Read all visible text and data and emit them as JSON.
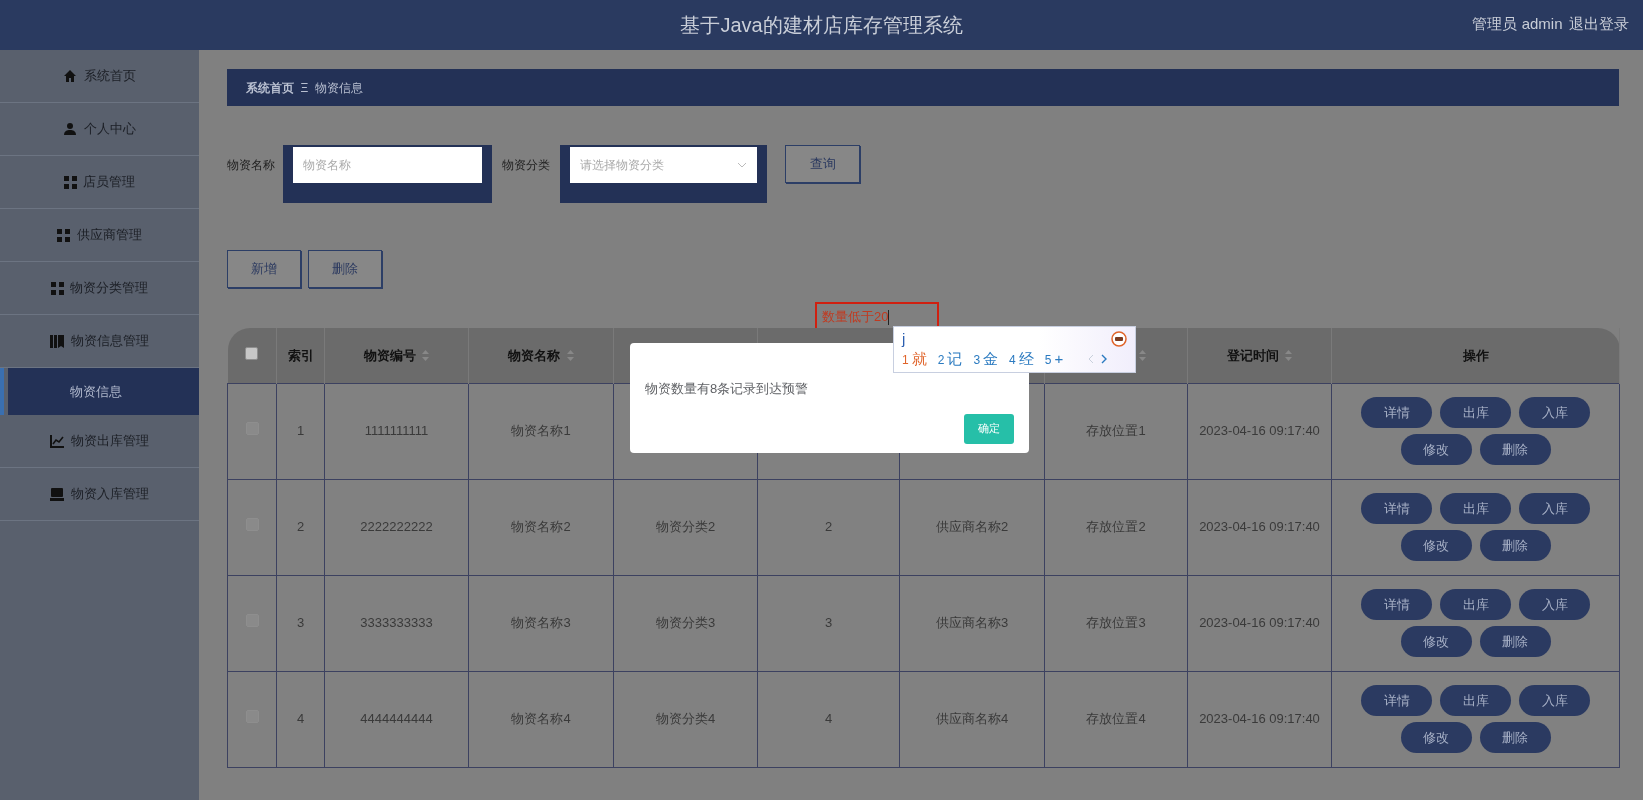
{
  "header": {
    "title": "基于Java的建材店库存管理系统",
    "user": "管理员 admin",
    "logout": "退出登录"
  },
  "sidebar": {
    "items": [
      {
        "label": "系统首页",
        "selected": false
      },
      {
        "label": "个人中心",
        "selected": false
      },
      {
        "label": "店员管理",
        "selected": false
      },
      {
        "label": "供应商管理",
        "selected": false
      },
      {
        "label": "物资分类管理",
        "selected": false
      },
      {
        "label": "物资信息管理",
        "selected": false,
        "children": [
          {
            "label": "物资信息",
            "selected": true
          }
        ]
      },
      {
        "label": "物资出库管理",
        "selected": false
      },
      {
        "label": "物资入库管理",
        "selected": false
      }
    ]
  },
  "breadcrumb": [
    "系统首页",
    "物资信息"
  ],
  "breadcrumb_separator": "Ξ",
  "search": {
    "fields": [
      {
        "label": "物资名称",
        "placeholder": "物资名称",
        "kind": "input"
      },
      {
        "label": "物资分类",
        "placeholder": "请选择物资分类",
        "kind": "select"
      }
    ],
    "button": "查询"
  },
  "toolbar": [
    "新增",
    "删除"
  ],
  "warning_input": {
    "value": "数量低于20"
  },
  "table": {
    "header_checked": false,
    "columns": [
      {
        "label": "索引",
        "sortable": false
      },
      {
        "label": "物资编号",
        "sortable": true
      },
      {
        "label": "物资名称",
        "sortable": true
      },
      {},
      {},
      {},
      {
        "sortable": true
      },
      {
        "label": "登记时间",
        "sortable": true
      },
      {
        "label": "操作",
        "sortable": false
      }
    ],
    "rows": [
      {
        "checked": false,
        "index": "1",
        "code": "1111111111",
        "name": "物资名称1",
        "location": "存放位置1",
        "time": "2023-04-16 09:17:40",
        "actions": [
          "详情",
          "出库",
          "入库",
          "修改",
          "删除"
        ]
      },
      {
        "checked": false,
        "index": "2",
        "code": "2222222222",
        "name": "物资名称2",
        "category": "物资分类2",
        "quantity": "2",
        "supplier": "供应商名称2",
        "location": "存放位置2",
        "time": "2023-04-16 09:17:40",
        "actions": [
          "详情",
          "出库",
          "入库",
          "修改",
          "删除"
        ]
      },
      {
        "checked": false,
        "index": "3",
        "code": "3333333333",
        "name": "物资名称3",
        "category": "物资分类3",
        "quantity": "3",
        "supplier": "供应商名称3",
        "location": "存放位置3",
        "time": "2023-04-16 09:17:40",
        "actions": [
          "详情",
          "出库",
          "入库",
          "修改",
          "删除"
        ]
      },
      {
        "checked": false,
        "index": "4",
        "code": "4444444444",
        "name": "物资名称4",
        "category": "物资分类4",
        "quantity": "4",
        "supplier": "供应商名称4",
        "location": "存放位置4",
        "time": "2023-04-16 09:17:40",
        "actions": [
          "详情",
          "出库",
          "入库",
          "修改",
          "删除"
        ]
      }
    ]
  },
  "dialog": {
    "message": "物资数量有8条记录到达预警",
    "button": "确定"
  },
  "ime": {
    "input": "j",
    "candidates": [
      {
        "number": "1",
        "text": "就",
        "selected": true
      },
      {
        "number": "2",
        "text": "记",
        "selected": false
      },
      {
        "number": "3",
        "text": "金",
        "selected": false
      },
      {
        "number": "4",
        "text": "经",
        "selected": false
      },
      {
        "number": "5",
        "text": "+",
        "selected": false
      }
    ]
  }
}
